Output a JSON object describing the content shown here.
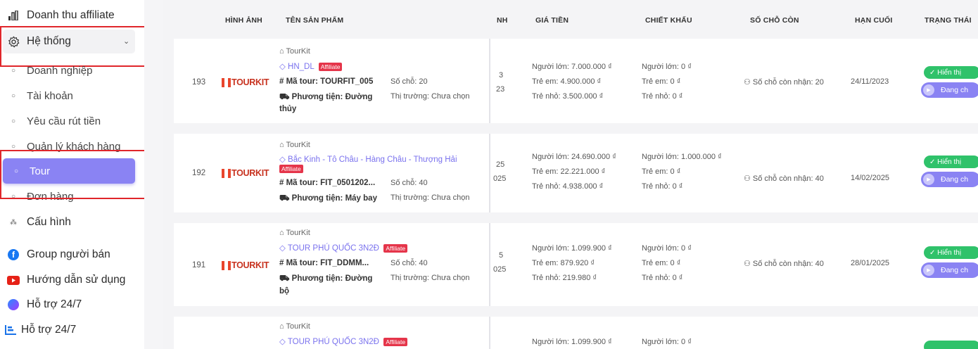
{
  "sidebar": {
    "items": [
      {
        "label": "Doanh thu affiliate",
        "icon": "bar-chart-icon"
      },
      {
        "label": "Hệ thống",
        "icon": "gear-icon"
      },
      {
        "label": "Doanh nghiệp",
        "icon": "circle-icon"
      },
      {
        "label": "Tài khoản",
        "icon": "circle-icon"
      },
      {
        "label": "Yêu cầu rút tiền",
        "icon": "circle-icon"
      },
      {
        "label": "Quản lý khách hàng",
        "icon": "circle-icon"
      },
      {
        "label": "Tour",
        "icon": "circle-icon"
      },
      {
        "label": "Đơn hàng",
        "icon": "circle-icon"
      },
      {
        "label": "Cấu hình",
        "icon": "grid-icon"
      },
      {
        "label": "Group người bán",
        "icon": "facebook-icon"
      },
      {
        "label": "Hướng dẫn sử dụng",
        "icon": "youtube-icon"
      },
      {
        "label": "Hỗ trợ 24/7",
        "icon": "messenger-icon"
      },
      {
        "label": "Hỗ trợ 24/7",
        "icon": "chart-icon"
      }
    ],
    "colors": {
      "active": "#8a83f3",
      "highlight_box": "#e0262b"
    }
  },
  "table": {
    "headers": {
      "image": "HÌNH ẢNH",
      "name": "TÊN SẢN PHẨM",
      "partial": "NH",
      "price": "GIÁ TIỀN",
      "discount": "CHIẾT KHẤU",
      "slots": "SỐ CHỖ CÒN",
      "deadline": "HẠN CUỐI",
      "status": "TRẠNG THÁI"
    },
    "rows": [
      {
        "id": "193",
        "logo": "TOURKIT",
        "vendor": "TourKit",
        "name": "HN_DL",
        "badge": "Affiliate",
        "code": "# Mã tour: TOURFIT_005",
        "seats": "Số chỗ: 20",
        "transport": "Phương tiện: Đường thủy",
        "transport_line1": "Phương tiện: Đường",
        "transport_line2": "thủy",
        "market": "Thị trường: Chưa chọn",
        "partial1": "3",
        "partial2": "23",
        "price_adult": "Người lớn: 7.000.000 ₫",
        "price_child": "Trẻ em: 4.900.000 ₫",
        "price_infant": "Trẻ nhỏ: 3.500.000 ₫",
        "disc_adult": "Người lớn: 0 ₫",
        "disc_child": "Trẻ em: 0 ₫",
        "disc_infant": "Trẻ nhỏ: 0 ₫",
        "slots": "Số chỗ còn nhận: 20",
        "deadline": "24/11/2023",
        "status1": "✓ Hiển thị",
        "status2": "Đang ch"
      },
      {
        "id": "192",
        "logo": "TOURKIT",
        "vendor": "TourKit",
        "name": "Bắc Kinh - Tô Châu - Hàng Châu - Thượng Hải",
        "badge": "Affiliate",
        "code": "# Mã tour: FIT_0501202...",
        "seats": "Số chỗ: 40",
        "transport_line1": "Phương tiện: Máy bay",
        "transport_line2": "",
        "market": "Thị trường: Chưa chọn",
        "partial1": "25",
        "partial2": "025",
        "price_adult": "Người lớn: 24.690.000 ₫",
        "price_child": "Trẻ em: 22.221.000 ₫",
        "price_infant": "Trẻ nhỏ: 4.938.000 ₫",
        "disc_adult": "Người lớn: 1.000.000 ₫",
        "disc_child": "Trẻ em: 0 ₫",
        "disc_infant": "Trẻ nhỏ: 0 ₫",
        "slots": "Số chỗ còn nhận: 40",
        "deadline": "14/02/2025",
        "status1": "✓ Hiển thị",
        "status2": "Đang ch"
      },
      {
        "id": "191",
        "logo": "TOURKIT",
        "vendor": "TourKit",
        "name": "TOUR PHÚ QUỐC 3N2Đ",
        "badge": "Affiliate",
        "code": "# Mã tour: FIT_DDMM...",
        "seats": "Số chỗ: 40",
        "transport_line1": "Phương tiện: Đường",
        "transport_line2": "bộ",
        "market": "Thị trường: Chưa chọn",
        "partial1": "5",
        "partial2": "025",
        "price_adult": "Người lớn: 1.099.900 ₫",
        "price_child": "Trẻ em: 879.920 ₫",
        "price_infant": "Trẻ nhỏ: 219.980 ₫",
        "disc_adult": "Người lớn: 0 ₫",
        "disc_child": "Trẻ em: 0 ₫",
        "disc_infant": "Trẻ nhỏ: 0 ₫",
        "slots": "Số chỗ còn nhận: 40",
        "deadline": "28/01/2025",
        "status1": "✓ Hiển thị",
        "status2": "Đang ch"
      },
      {
        "vendor": "TourKit",
        "name": "TOUR PHÚ QUỐC 3N2Đ",
        "badge": "Affiliate",
        "price_adult": "Người lớn: 1.099.900 ₫",
        "disc_adult": "Người lớn: 0 ₫"
      }
    ],
    "colors": {
      "link": "#7a72ee",
      "badge": "#e5354a",
      "shown": "#2fc26a",
      "running": "#8a83f3"
    }
  }
}
